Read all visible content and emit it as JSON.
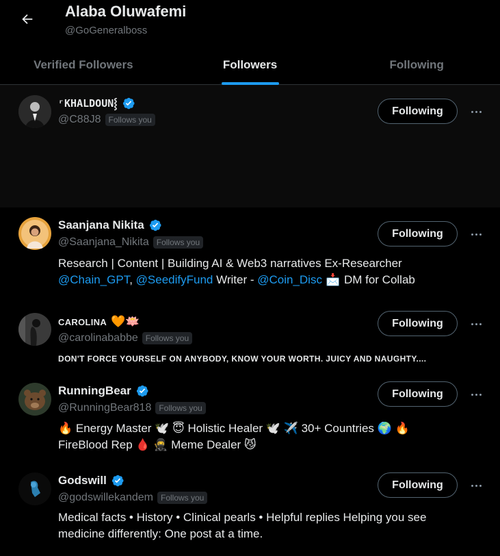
{
  "profile": {
    "name": "Alaba Oluwafemi",
    "handle": "@GoGeneralboss"
  },
  "tabs": [
    {
      "label": "Verified Followers"
    },
    {
      "label": "Followers"
    },
    {
      "label": "Following"
    }
  ],
  "accent_color": "#1d9bf0",
  "follow_label": "Following",
  "follows_you_label": "Follows you",
  "users": [
    {
      "name": "ʳKHALDOUN⸾",
      "handle": "@C88J8",
      "verified": true
    },
    {
      "name": "Saanjana Nikita",
      "handle": "@Saanjana_Nikita",
      "verified": true,
      "bio": {
        "line1": "Research | Content | Building AI & Web3 narratives Ex-Researcher",
        "link1": "@Chain_GPT",
        "sep1": ", ",
        "link2": "@SeedifyFund",
        "mid": " Writer - ",
        "link3": "@Coin_Disc",
        "emoji": " 📩 ",
        "tail": "DM for Collab"
      }
    },
    {
      "name": "CAROLINA",
      "name_emoji": "🧡🪷",
      "handle": "@carolinababbe",
      "verified": false,
      "bio": {
        "text": "DON'T FORCE YOURSELF ON ANYBODY, KNOW YOUR WORTH. JUICY AND NAUGHTY...."
      }
    },
    {
      "name": "RunningBear",
      "handle": "@RunningBear818",
      "verified": true,
      "bio": {
        "line1": "🔥 Energy Master 🕊️ 😇 Holistic Healer 🕊️ ✈️ 30+ Countries 🌍 🔥",
        "line2": "FireBlood Rep 🩸 🥷 Meme Dealer 😼"
      }
    },
    {
      "name": "Godswill",
      "handle": "@godswillekandem",
      "verified": true,
      "bio": {
        "line1": "Medical facts • History • Clinical pearls • Helpful replies Helping you see",
        "line2": "medicine differently: One post at a time."
      }
    }
  ]
}
